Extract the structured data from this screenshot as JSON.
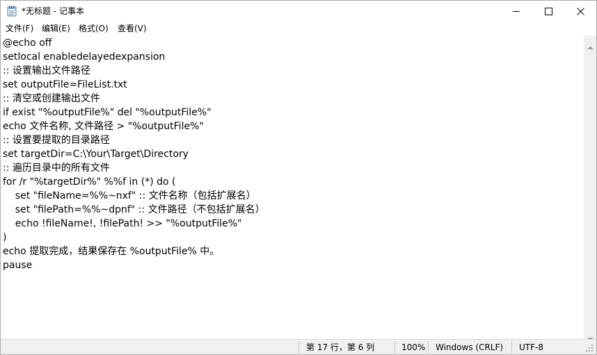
{
  "window": {
    "title": "*无标题 - 记事本",
    "icon": "notepad-icon"
  },
  "controls": {
    "minimize_icon": "minimize-icon",
    "maximize_icon": "maximize-icon",
    "close_icon": "close-icon"
  },
  "menu": {
    "items": [
      "文件(F)",
      "编辑(E)",
      "格式(O)",
      "查看(V)"
    ]
  },
  "editor": {
    "lines": [
      "@echo off",
      "setlocal enabledelayedexpansion",
      ":: 设置输出文件路径",
      "set outputFile=FileList.txt",
      ":: 清空或创建输出文件",
      "if exist \"%outputFile%\" del \"%outputFile%\"",
      "echo 文件名称, 文件路径 > \"%outputFile%\"",
      ":: 设置要提取的目录路径",
      "set targetDir=C:\\Your\\Target\\Directory",
      ":: 遍历目录中的所有文件",
      "for /r \"%targetDir%\" %%f in (*) do (",
      "    set \"fileName=%%~nxf\" :: 文件名称（包括扩展名）",
      "    set \"filePath=%%~dpnf\" :: 文件路径（不包括扩展名）",
      "    echo !fileName!, !filePath! >> \"%outputFile%\"",
      ")",
      "echo 提取完成，结果保存在 %outputFile% 中。",
      "pause"
    ]
  },
  "status": {
    "position": "第 17 行，第 6 列",
    "zoom": "100%",
    "line_ending": "Windows (CRLF)",
    "encoding": "UTF-8"
  }
}
